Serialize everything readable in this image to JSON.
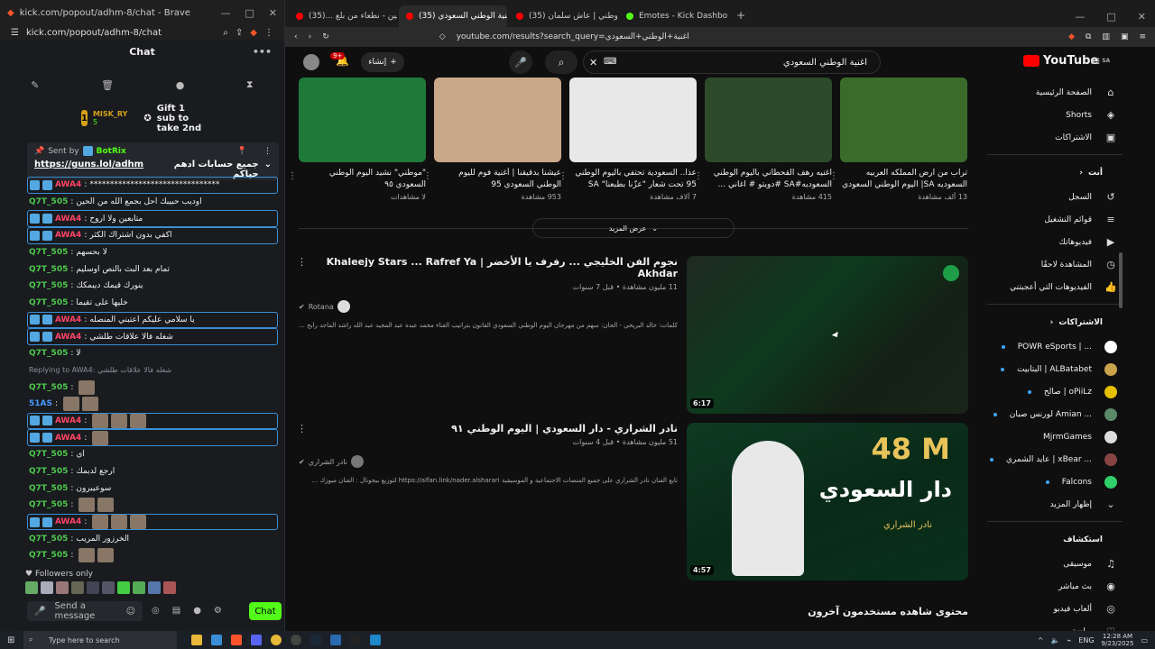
{
  "chat_window": {
    "title_bar": "kick.com/popout/adhm-8/chat - Brave",
    "url": "kick.com/popout/adhm-8/chat",
    "header": "Chat",
    "gift": {
      "rank": "1",
      "user": "MISK_RY",
      "count": "5",
      "text": "Gift 1 sub to take 2nd"
    },
    "pinned": {
      "sent_by": "Sent by",
      "bot": "BotRix",
      "link": "https://guns.lol/adhm",
      "text": "جميع حسابات ادهم حياكم"
    },
    "messages": [
      {
        "user": "AWA4",
        "text": "********************************",
        "hl": true
      },
      {
        "user": "Q7T_505",
        "text": "اوديب حبيبك احل بجمع الله من الحين",
        "hl": false
      },
      {
        "user": "AWA4",
        "text": "متابعين ولا اروح",
        "hl": true
      },
      {
        "user": "AWA4",
        "text": "اكفي بدون اشتراك الكثر",
        "hl": true
      },
      {
        "user": "Q7T_505",
        "text": "لا بحسهم",
        "hl": false
      },
      {
        "user": "Q7T_505",
        "text": "تمام بعد البث بالنص اوسليم",
        "hl": false
      },
      {
        "user": "Q7T_505",
        "text": "ينورك قيمك ديبمكك",
        "hl": false
      },
      {
        "user": "Q7T_505",
        "text": "خليها على تقيما",
        "hl": false
      },
      {
        "user": "AWA4",
        "text": "يا سلامي عليكم اعتبني المنصله",
        "hl": true
      },
      {
        "user": "AWA4",
        "text": "شغله فالا علاقات طلشي",
        "hl": true
      },
      {
        "user": "Q7T_505",
        "text": "لا",
        "hl": false
      },
      {
        "reply": "Replying to AWA4: شغله فالا علاقات طلشي"
      },
      {
        "user": "Q7T_505",
        "text": "",
        "hl": false
      },
      {
        "user": "51AS",
        "text": "",
        "hl": false
      },
      {
        "user": "AWA4",
        "text": "",
        "hl": true
      },
      {
        "user": "AWA4",
        "text": "",
        "hl": true
      },
      {
        "user": "Q7T_505",
        "text": "اي",
        "hl": false
      },
      {
        "user": "Q7T_505",
        "text": "ارجع لدبمك",
        "hl": false
      },
      {
        "user": "Q7T_505",
        "text": "سوعيبرون",
        "hl": false
      },
      {
        "user": "Q7T_505",
        "text": "",
        "hl": false
      },
      {
        "user": "AWA4",
        "text": "",
        "hl": true
      },
      {
        "user": "Q7T_505",
        "text": "الخرزور المريب",
        "hl": false
      },
      {
        "user": "Q7T_505",
        "text": "",
        "hl": false
      }
    ],
    "followers_only": "Followers only",
    "send_placeholder": "Send a message",
    "chat_button": "Chat"
  },
  "browser": {
    "tabs": [
      {
        "label": "سعوديين - نطعاء من بلع ...(35)#",
        "active": false,
        "kind": "yt"
      },
      {
        "label": "(35) اغنية الوطني السعودي - ube",
        "active": true,
        "kind": "yt"
      },
      {
        "label": "(35) اغاني اليوم الوطني | عاش سلمان",
        "active": false,
        "kind": "yt"
      },
      {
        "label": "Emotes - Kick Dashboard",
        "active": false,
        "kind": "kick"
      }
    ],
    "url": "youtube.com/results?search_query=اغنية+الوطني+السعودي"
  },
  "youtube": {
    "search_query": "اغنية الوطني السعودي",
    "create_label": "إنشاء",
    "notif_count": "9+",
    "logo_text": "YouTube",
    "logo_region": "SA",
    "shelf": [
      {
        "title": "تراب من ارض المملكه العربيه السعوديه SA| اليوم الوطني السعودي",
        "views": "13 ألف مشاهدة",
        "color": "#3a6b2a"
      },
      {
        "title": "اغنيه رهف القحطاني باليوم الوطني السعوديه#SA #دويتو # اغاني ...",
        "views": "415 مشاهدة",
        "color": "#2d4a2a"
      },
      {
        "title": "عذا.. السعودية تحتفي باليوم الوطني 95 تحت شعار \"عزّنا بطبعنا\" SA",
        "views": "7 آلاف مشاهدة",
        "color": "#e8e8e8"
      },
      {
        "title": "عيشنا بدقيقنا | أغنية فوم لليوم الوطني السعودي 95",
        "views": "953 مشاهدة",
        "color": "#c9a88a"
      },
      {
        "title": "\"موطني\" نشيد اليوم الوطني السعودي ٩٥",
        "views": "لا مشاهدات",
        "color": "#1f7a3a"
      }
    ],
    "show_more": "عرض المزيد",
    "videos": [
      {
        "title": "نجوم الفن الخليجي ... رفرف يا الأخضر | Khaleejy Stars ... Rafref Ya Akhdar",
        "meta": "11 مليون مشاهدة • قبل 7 سنوات",
        "channel": "Rotana",
        "desc": "كلمات: خالد البريخي - الحان: سهم من مهرجان اليوم الوطني السعودي القانون بتراتيب الغناء محمد عبدة عبد المجيد عبد الله راشد الماجد رابح ...",
        "duration": "6:17"
      },
      {
        "title": "نادر الشراري - دار السعودي | اليوم الوطني ٩١",
        "meta": "51 مليون مشاهدة • قبل 4 سنوات",
        "channel": "نادر الشراري",
        "desc": "تابع الفنان نادر الشراري على جميع المنصات الاجتماعية و الموسيقية https://alfan.link/nader.alsharari لتوزيع بيجونال : الفنان ميوزك ...",
        "duration": "4:57",
        "thumb_big": "48 M",
        "thumb_text": "دار السعودي",
        "thumb_name": "نادر الشراري"
      }
    ],
    "section_heading": "محتوى شاهده مستخدمون آخرون",
    "sidebar": {
      "main": [
        {
          "label": "الصفحة الرئيسية",
          "icon": "⌂"
        },
        {
          "label": "Shorts",
          "icon": "◈"
        },
        {
          "label": "الاشتراكات",
          "icon": "▣"
        }
      ],
      "you_header": "أنت",
      "you": [
        {
          "label": "السجل",
          "icon": "↺"
        },
        {
          "label": "قوائم التشغيل",
          "icon": "≡"
        },
        {
          "label": "فيديوهاتك",
          "icon": "▶"
        },
        {
          "label": "المشاهدة لاحقًا",
          "icon": "◷"
        },
        {
          "label": "الفيديوهات التي أعجبتني",
          "icon": "👍"
        }
      ],
      "subs_header": "الاشتراكات",
      "subs": [
        {
          "label": "POWR eSports | ...",
          "color": "#ffffff",
          "dot": true
        },
        {
          "label": "البتابيت | ALBatabet",
          "color": "#c9a24a",
          "dot": true
        },
        {
          "label": "صالح | oPiiLz",
          "color": "#e6c000",
          "dot": true
        },
        {
          "label": "لورنس صبان Amian ...",
          "color": "#5a8a6a",
          "dot": true
        },
        {
          "label": "MjrmGames",
          "color": "#dddddd",
          "dot": false
        },
        {
          "label": "عايد الشمري | xBear ...",
          "color": "#884444",
          "dot": true
        },
        {
          "label": "Falcons",
          "color": "#2fcf6a",
          "dot": true
        }
      ],
      "show_more": "إظهار المزيد",
      "explore_header": "استكشاف",
      "explore": [
        {
          "label": "موسيقى",
          "icon": "♫"
        },
        {
          "label": "بث مباشر",
          "icon": "◉"
        },
        {
          "label": "ألعاب فيديو",
          "icon": "◎"
        },
        {
          "label": "رياضة",
          "icon": "♡"
        }
      ]
    }
  },
  "taskbar": {
    "search_placeholder": "Type here to search",
    "lang": "ENG",
    "time": "12:28 AM",
    "date": "9/23/2025"
  }
}
